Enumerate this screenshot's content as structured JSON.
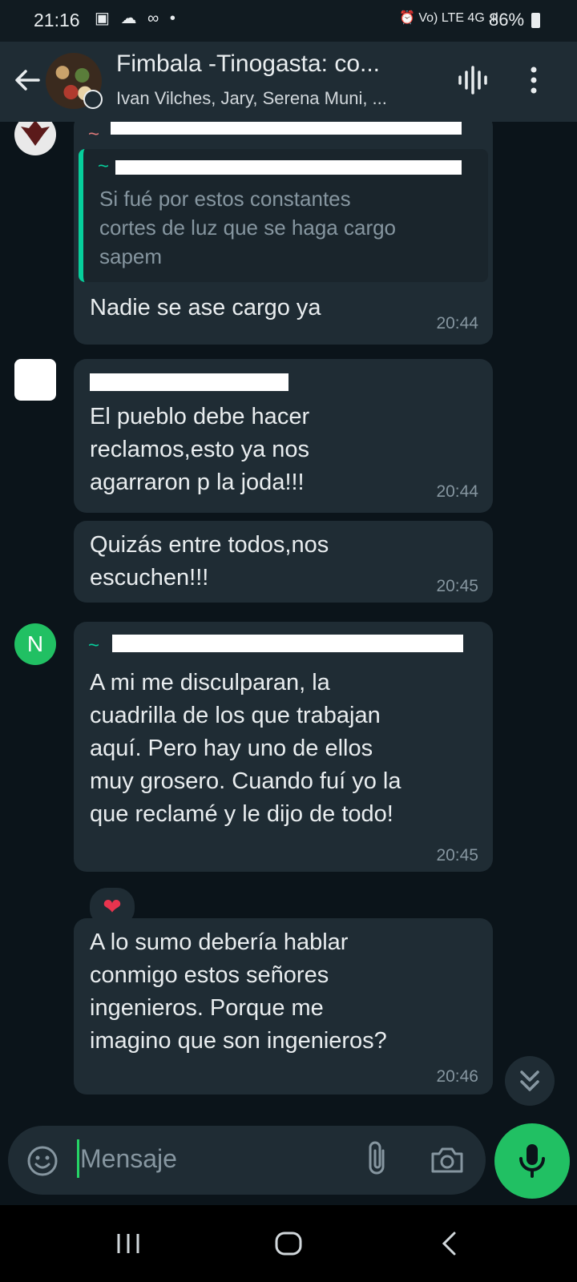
{
  "status_bar": {
    "time": "21:16",
    "left_icons": "▣ ☁ ∞ •",
    "right_icons": "⏰ Vo) LTE 4G .ıl",
    "battery": "86%"
  },
  "header": {
    "title": "Fimbala -Tinogasta: co...",
    "subtitle": "Ivan Vilches, Jary, Serena Muni, ..."
  },
  "messages": [
    {
      "quote_text": "Si fué por estos constantes\ncortes de luz que se haga cargo\nsapem",
      "text": "Nadie se ase cargo ya",
      "time": "20:44"
    },
    {
      "text": "El pueblo debe hacer\nreclamos,esto ya nos\nagarraron p la joda!!!",
      "time": "20:44"
    },
    {
      "text": "Quizás entre todos,nos\nescuchen!!!",
      "time": "20:45"
    },
    {
      "avatar_letter": "N",
      "text": "A mi me disculparan, la\ncuadrilla de los que trabajan\naquí. Pero hay uno de ellos\nmuy grosero. Cuando fuí yo la\nque reclamé y le dijo de todo!",
      "time": "20:45",
      "reaction": "❤"
    },
    {
      "text": "A lo sumo debería hablar\nconmigo estos señores\ningenieros. Porque me\nimagino que son ingenieros?",
      "time": "20:46"
    }
  ],
  "input": {
    "placeholder": "Mensaje"
  },
  "colors": {
    "accent": "#25d366",
    "bubble": "#1f2c34",
    "background": "#0b141a"
  }
}
